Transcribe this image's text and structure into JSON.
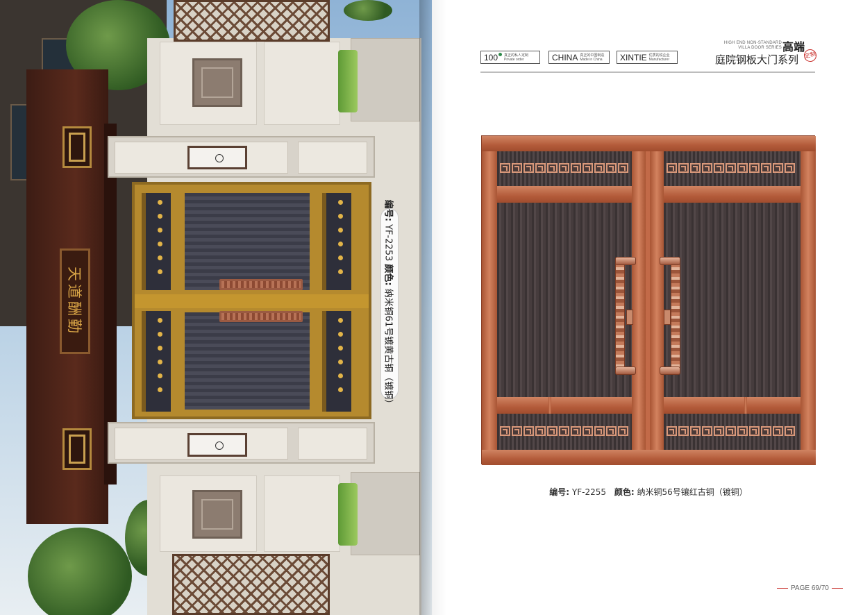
{
  "left_photo": {
    "caption_code_label": "编号:",
    "caption_code_value": "YF-2253",
    "caption_color_label": "颜色:",
    "caption_color_value": "纳米铜61号镀黄古铜（镀铜）",
    "sign_text": "天道酬勤"
  },
  "header": {
    "badge_100_main": "100",
    "badge_100_sub1": "真正的私人定制",
    "badge_100_sub2": "Private order",
    "badge_china_main": "CHINA",
    "badge_china_sub1": "真正的中国制造",
    "badge_china_sub2": "Made in China",
    "badge_xintie_main": "XINTIE",
    "badge_xintie_sub1": "优质的铁企业",
    "badge_xintie_sub2": "Manufacturer",
    "series_en_line1": "HIGH END NON-STANDARD",
    "series_en_line2": "VILLA DOOR SERIES",
    "series_top": "高端",
    "series_title": "庭院钢板大门系列",
    "seal_text": "定制"
  },
  "product": {
    "code_label": "编号:",
    "code_value": "YF-2255",
    "color_label": "颜色:",
    "color_value": "纳米铜56号镶红古铜（镀铜）"
  },
  "footer": {
    "page": "PAGE 69/70"
  }
}
